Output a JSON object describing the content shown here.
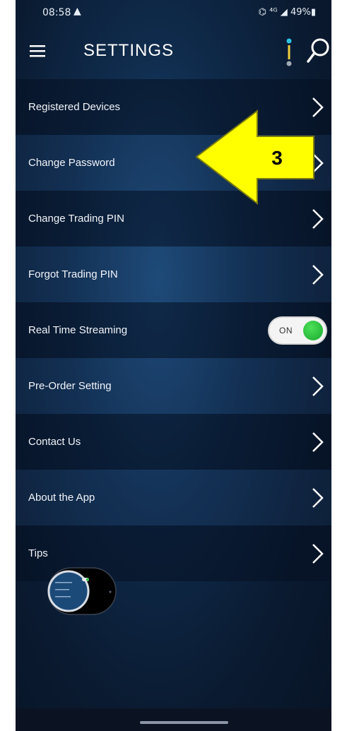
{
  "status_bar": {
    "time": "08:58",
    "alert_icon": "warning-triangle-icon",
    "right_text": "⌬ ⁴ᴳ ◢ 49%▮",
    "battery": "49%"
  },
  "app_bar": {
    "title": "SETTINGS",
    "menu_icon": "hamburger-menu-icon",
    "more_icon": "vertical-dots-icon",
    "search_icon": "search-icon"
  },
  "settings_items": [
    {
      "label": "Registered Devices",
      "type": "link"
    },
    {
      "label": "Change Password",
      "type": "link"
    },
    {
      "label": "Change Trading PIN",
      "type": "link"
    },
    {
      "label": "Forgot Trading PIN",
      "type": "link"
    },
    {
      "label": "Real Time Streaming",
      "type": "toggle",
      "toggle_label": "ON",
      "toggle_on": true
    },
    {
      "label": "Pre-Order Setting",
      "type": "link"
    },
    {
      "label": "Contact Us",
      "type": "link"
    },
    {
      "label": "About the App",
      "type": "link"
    },
    {
      "label": "Tips",
      "type": "link"
    }
  ],
  "annotation": {
    "step_number": "3",
    "arrow_color": "#ffff00",
    "points_to": "Change Password"
  },
  "colors": {
    "background": "#0f2a4a",
    "text": "#f2f5fa",
    "toggle_on": "#22b832",
    "accent_dots": "#2ec4e6"
  }
}
